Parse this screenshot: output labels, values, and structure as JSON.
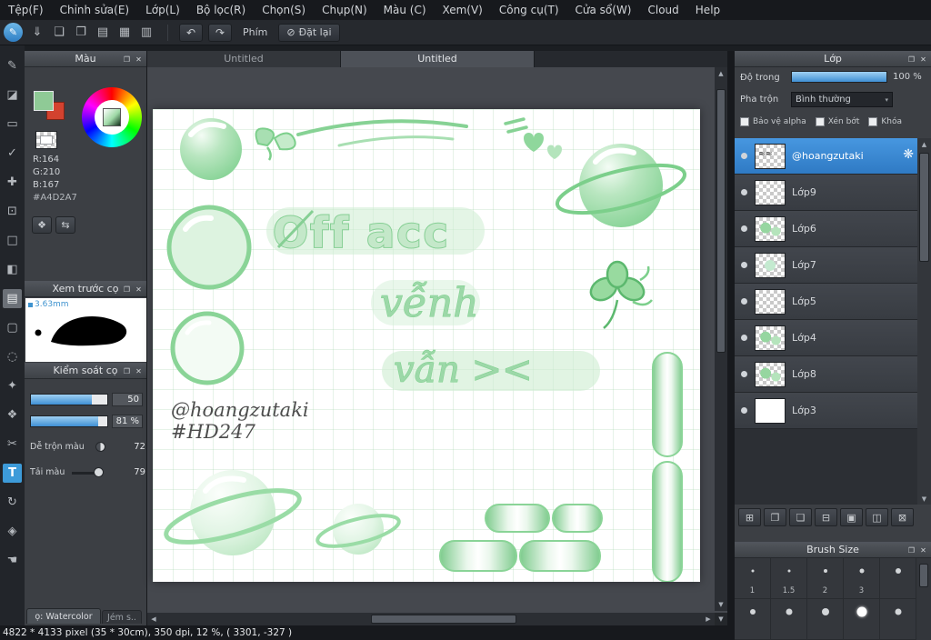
{
  "glyphs": {
    "popup": "❐",
    "close": "✕",
    "undo": "↶",
    "redo": "↷",
    "block": "⊘",
    "dropdown": "▾",
    "up": "▲",
    "down": "▼",
    "left": "◀",
    "right": "▶",
    "gear": "❋",
    "corner": "▼"
  },
  "menu": {
    "items": [
      "Tệp(F)",
      "Chỉnh sửa(E)",
      "Lớp(L)",
      "Bộ lọc(R)",
      "Chọn(S)",
      "Chụp(N)",
      "Màu (C)",
      "Xem(V)",
      "Công cụ(T)",
      "Cửa sổ(W)",
      "Cloud",
      "Help"
    ]
  },
  "toolbar": {
    "active_tool_glyph": "✎",
    "icons": [
      {
        "name": "save-icon",
        "glyph": "⇓"
      },
      {
        "name": "comment-icon",
        "glyph": "❏"
      },
      {
        "name": "chat-icon",
        "glyph": "❐"
      },
      {
        "name": "document-icon",
        "glyph": "▤"
      },
      {
        "name": "spread-icon",
        "glyph": "▦"
      },
      {
        "name": "table-icon",
        "glyph": "▥"
      }
    ],
    "keys_label": "Phím",
    "reset_label": "Đặt lại"
  },
  "tools": [
    {
      "name": "pen-tool",
      "glyph": "✎"
    },
    {
      "name": "eraser-tool",
      "glyph": "◪"
    },
    {
      "name": "select-tool",
      "glyph": "▭"
    },
    {
      "name": "snap-tool",
      "glyph": "✓"
    },
    {
      "name": "move-tool",
      "glyph": "✚"
    },
    {
      "name": "transform-tool",
      "glyph": "⊡"
    },
    {
      "name": "shape-brush-tool",
      "glyph": "□"
    },
    {
      "name": "fill-tool",
      "glyph": "◧"
    },
    {
      "name": "gradient-tool",
      "glyph": "▤"
    },
    {
      "name": "marquee-tool",
      "glyph": "▢"
    },
    {
      "name": "lasso-tool",
      "glyph": "◌"
    },
    {
      "name": "magic-wand-tool",
      "glyph": "✦"
    },
    {
      "name": "pattern-tool",
      "glyph": "❖"
    },
    {
      "name": "divide-tool",
      "glyph": "✂"
    },
    {
      "name": "text-tool",
      "glyph": "T"
    },
    {
      "name": "rotate-tool",
      "glyph": "↻"
    },
    {
      "name": "eyedropper-tool",
      "glyph": "◈"
    },
    {
      "name": "hand-tool",
      "glyph": "☚"
    }
  ],
  "color_panel": {
    "title": "Màu",
    "r": "R:164",
    "g": "G:210",
    "b": "B:167",
    "hex": "#A4D2A7"
  },
  "brush_preview_panel": {
    "title": "Xem trước cọ",
    "size_label": "3.63mm"
  },
  "brush_control_panel": {
    "title": "Kiểm soát cọ",
    "value1": "50",
    "value2": "81 %",
    "mix_label": "Dễ trộn màu",
    "mix_value": "72",
    "load_label": "Tải màu",
    "load_value": "79"
  },
  "bottom_tabs": {
    "tab1": "ọ: Watercolor",
    "tab2": "Jém s.."
  },
  "canvas": {
    "tab1": "Untitled",
    "tab2": "Untitled",
    "art": {
      "line1": "Off acc",
      "line2": "vễnh",
      "line3": "vẫn ><",
      "handle": "@hoangzutaki",
      "hashtag": "#HD247"
    }
  },
  "layers_panel": {
    "title": "Lớp",
    "opacity_label": "Độ trong",
    "opacity_value": "100 %",
    "blend_label": "Pha trộn",
    "blend_value": "Bình thường",
    "alpha_label": "Bảo vệ alpha",
    "clip_label": "Xén bớt",
    "lock_label": "Khóa",
    "layers": [
      {
        "name": "@hoangzutaki"
      },
      {
        "name": "Lớp9"
      },
      {
        "name": "Lớp6"
      },
      {
        "name": "Lớp7"
      },
      {
        "name": "Lớp5"
      },
      {
        "name": "Lớp4"
      },
      {
        "name": "Lớp8"
      },
      {
        "name": "Lớp3"
      }
    ],
    "buttons": [
      {
        "name": "add-layer-button",
        "glyph": "⊞"
      },
      {
        "name": "duplicate-layer-button",
        "glyph": "❐"
      },
      {
        "name": "paste-layer-button",
        "glyph": "❏"
      },
      {
        "name": "merge-layer-button",
        "glyph": "⊟"
      },
      {
        "name": "folder-button",
        "glyph": "▣"
      },
      {
        "name": "move-layer-button",
        "glyph": "◫"
      },
      {
        "name": "delete-layer-button",
        "glyph": "⊠"
      }
    ]
  },
  "brush_size_panel": {
    "title": "Brush Size",
    "cells": [
      {
        "label": "1"
      },
      {
        "label": "1.5"
      },
      {
        "label": "2"
      },
      {
        "label": "3"
      },
      {
        "label": ""
      },
      {
        "label": ""
      },
      {
        "label": ""
      },
      {
        "label": ""
      },
      {
        "label": ""
      },
      {
        "label": ""
      }
    ]
  },
  "status_bar": {
    "text": "4822 * 4133 pixel  (35 * 30cm),  350 dpi,  12 %,  ( 3301, -327 )"
  }
}
